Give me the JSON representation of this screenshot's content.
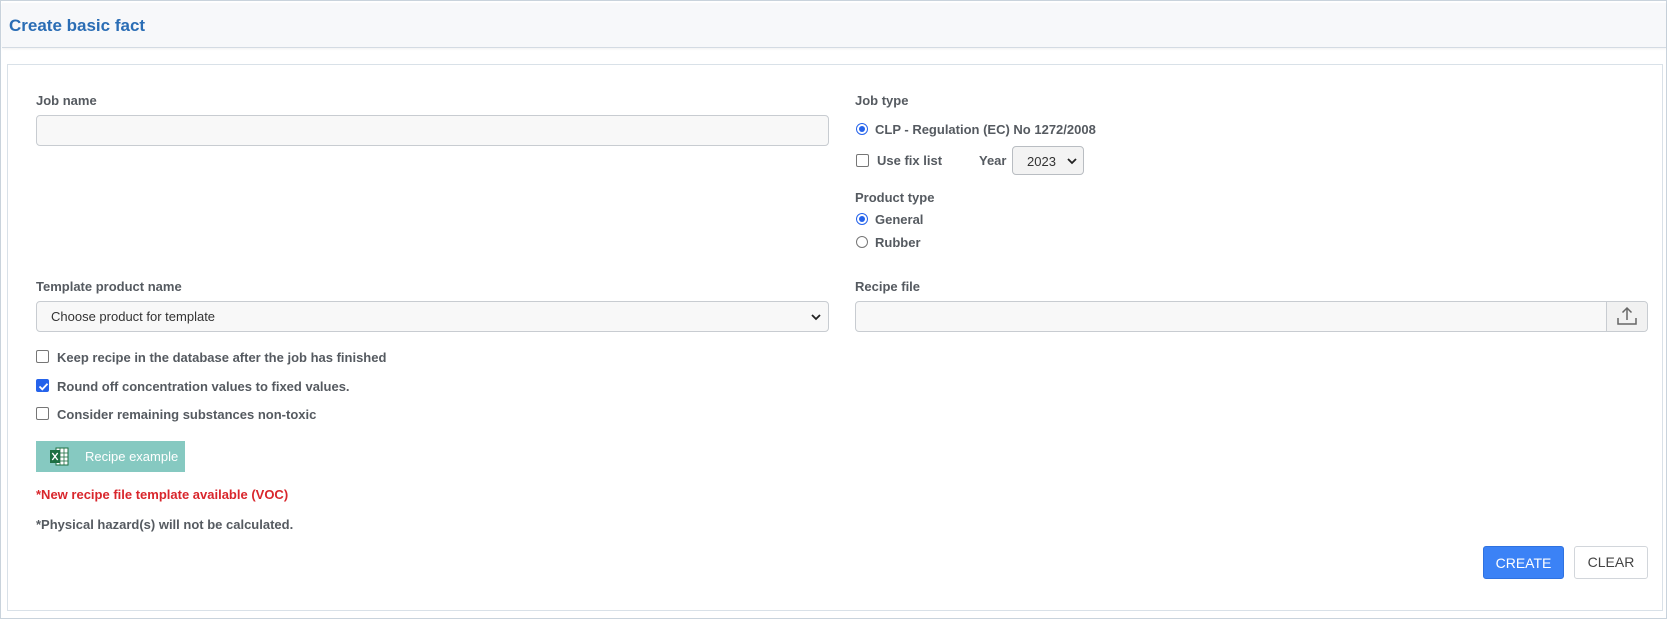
{
  "header": {
    "title": "Create basic fact"
  },
  "form": {
    "job_name": {
      "label": "Job name",
      "value": "",
      "placeholder": ""
    },
    "job_type": {
      "label": "Job type",
      "option_clp": {
        "label": "CLP - Regulation (EC) No 1272/2008",
        "selected": true
      },
      "use_fix_list": {
        "label": "Use fix list",
        "checked": false
      },
      "year": {
        "label": "Year",
        "value": "2023"
      }
    },
    "product_type": {
      "label": "Product type",
      "options": [
        {
          "label": "General",
          "selected": true
        },
        {
          "label": "Rubber",
          "selected": false
        }
      ]
    },
    "template_product": {
      "label": "Template product name",
      "selected": "Choose product for template"
    },
    "recipe_file": {
      "label": "Recipe file",
      "value": ""
    },
    "checkboxes": [
      {
        "label": "Keep recipe in the database after the job has finished",
        "checked": false
      },
      {
        "label": "Round off concentration values to fixed values.",
        "checked": true
      },
      {
        "label": "Consider remaining substances non-toxic",
        "checked": false
      }
    ],
    "recipe_example_label": "Recipe example",
    "note_voc": "*New recipe file template available (VOC)",
    "note_physical": "*Physical hazard(s) will not be calculated."
  },
  "actions": {
    "create_label": "CREATE",
    "clear_label": "CLEAR"
  },
  "icons": {
    "excel": "excel-icon",
    "upload": "upload-icon",
    "chevron": "chevron-down-icon"
  },
  "colors": {
    "title": "#2a6db5",
    "accent": "#3b82f6",
    "recipe_button": "#86c9c1",
    "warning_text": "#d9262c"
  }
}
